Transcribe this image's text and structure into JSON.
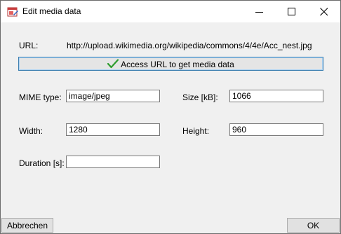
{
  "window": {
    "title": "Edit media data"
  },
  "url": {
    "label": "URL:",
    "value": "http://upload.wikimedia.org/wikipedia/commons/4/4e/Acc_nest.jpg"
  },
  "access_button": {
    "label": "Access URL to get media data",
    "icon": "checkmark-icon",
    "icon_color": "#2e9c2e"
  },
  "fields": {
    "mime": {
      "label": "MIME type:",
      "value": "image/jpeg"
    },
    "size": {
      "label": "Size [kB]:",
      "value": "1066"
    },
    "width": {
      "label": "Width:",
      "value": "1280"
    },
    "height": {
      "label": "Height:",
      "value": "960"
    },
    "duration": {
      "label": "Duration [s]:",
      "value": ""
    }
  },
  "footer": {
    "cancel_label": "Abbrechen",
    "ok_label": "OK"
  }
}
